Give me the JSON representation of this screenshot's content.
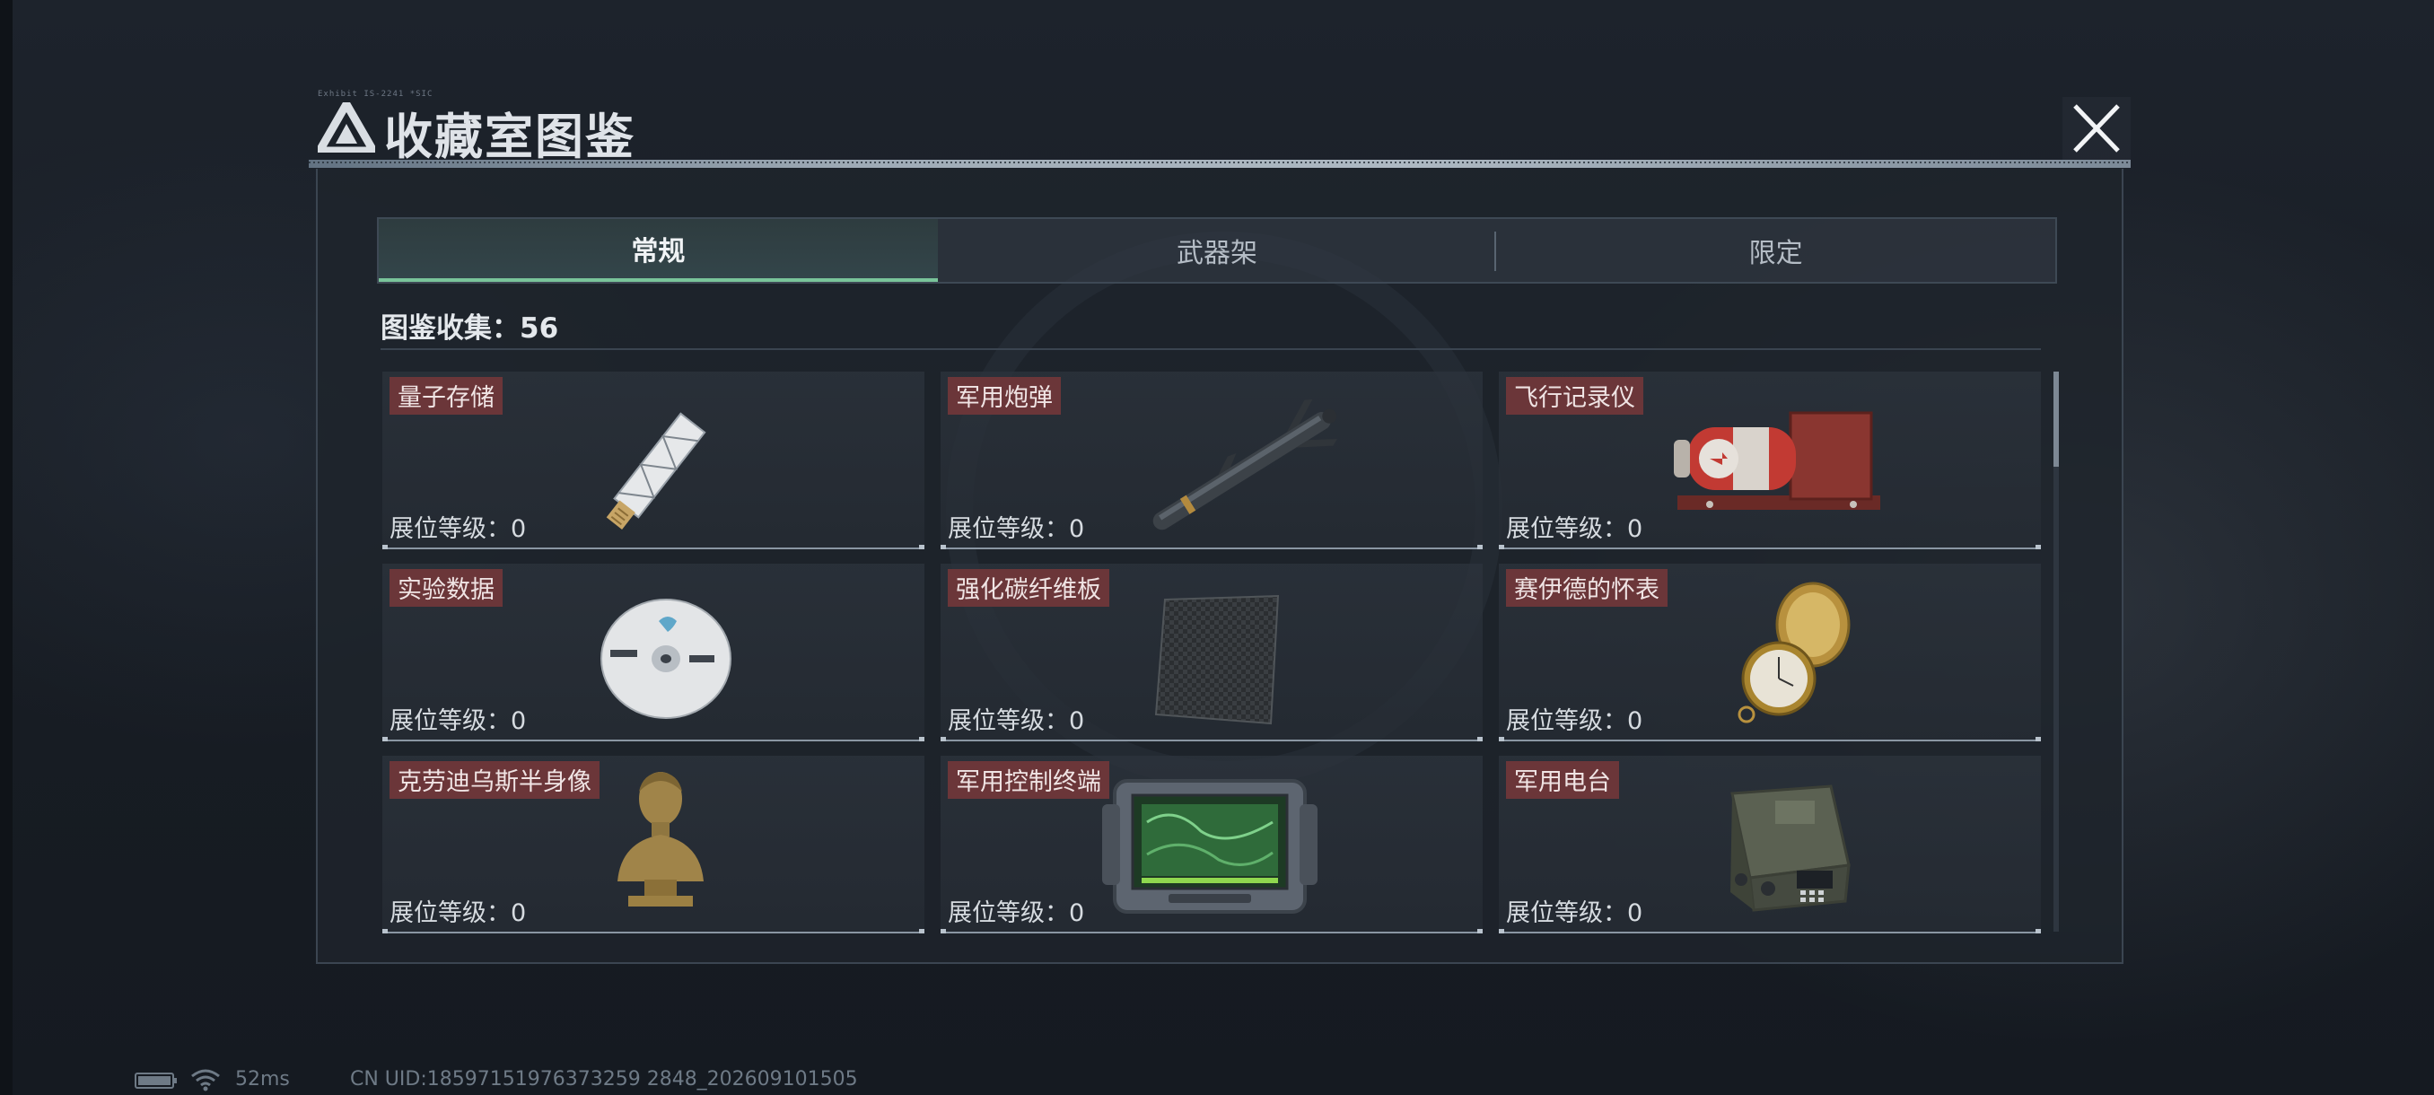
{
  "header": {
    "tag": "Exhibit IS-2241 *SIC",
    "title": "收藏室图鉴",
    "close_label": "close"
  },
  "tabs": [
    {
      "label": "常规",
      "active": true
    },
    {
      "label": "武器架",
      "active": false
    },
    {
      "label": "限定",
      "active": false
    }
  ],
  "collection": {
    "label": "图鉴收集：",
    "count": "56"
  },
  "items": [
    {
      "name": "量子存储",
      "level": "展位等级：0",
      "icon": "usb-drive-icon"
    },
    {
      "name": "军用炮弹",
      "level": "展位等级：0",
      "icon": "missile-icon"
    },
    {
      "name": "飞行记录仪",
      "level": "展位等级：0",
      "icon": "flight-recorder-icon"
    },
    {
      "name": "实验数据",
      "level": "展位等级：0",
      "icon": "disc-icon"
    },
    {
      "name": "强化碳纤维板",
      "level": "展位等级：0",
      "icon": "carbon-plate-icon"
    },
    {
      "name": "赛伊德的怀表",
      "level": "展位等级：0",
      "icon": "pocket-watch-icon"
    },
    {
      "name": "克劳迪乌斯半身像",
      "level": "展位等级：0",
      "icon": "bust-icon"
    },
    {
      "name": "军用控制终端",
      "level": "展位等级：0",
      "icon": "control-terminal-icon"
    },
    {
      "name": "军用电台",
      "level": "展位等级：0",
      "icon": "radio-icon"
    }
  ],
  "status": {
    "ping": "52ms",
    "uid": "CN UID:18597151976373259 2848_202609101505"
  },
  "colors": {
    "accent_tab": "#79c49a",
    "name_badge": "#6b3639"
  }
}
